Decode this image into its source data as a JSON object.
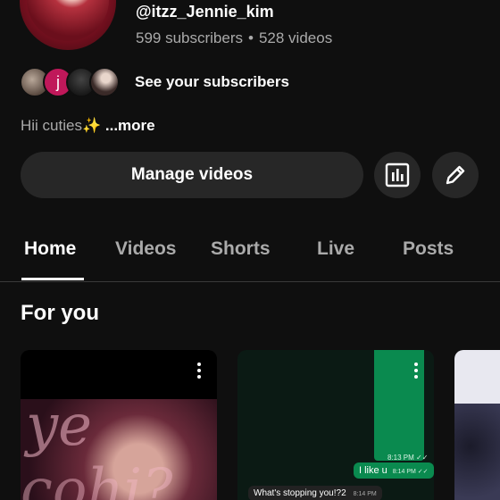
{
  "channel": {
    "handle": "@itzz_Jennie_kim",
    "subscribers": "599 subscribers",
    "separator": "•",
    "videos": "528 videos",
    "avatar_scribble": "🎀"
  },
  "subscribers_row": {
    "label": "See your subscribers",
    "mini_avatar_letter": "j"
  },
  "bio": {
    "text": "Hii cuties✨",
    "more": "...more"
  },
  "actions": {
    "manage_label": "Manage videos",
    "analytics_icon": "analytics-icon",
    "edit_icon": "pencil-icon"
  },
  "tabs": [
    {
      "label": "Home",
      "active": true
    },
    {
      "label": "Videos",
      "active": false
    },
    {
      "label": "Shorts",
      "active": false
    },
    {
      "label": "Live",
      "active": false
    },
    {
      "label": "Posts",
      "active": false
    }
  ],
  "section": {
    "title": "For you"
  },
  "cards": [
    {
      "neon_text_top": "ye",
      "neon_text_bottom": "cohi?"
    },
    {
      "msg_time_1": "8:13 PM ✓✓",
      "msg_out": "I like u",
      "msg_out_time": "8:14 PM ✓✓",
      "msg_in": "What's stopping you!?2",
      "msg_in_time": "8:14 PM"
    },
    {}
  ]
}
